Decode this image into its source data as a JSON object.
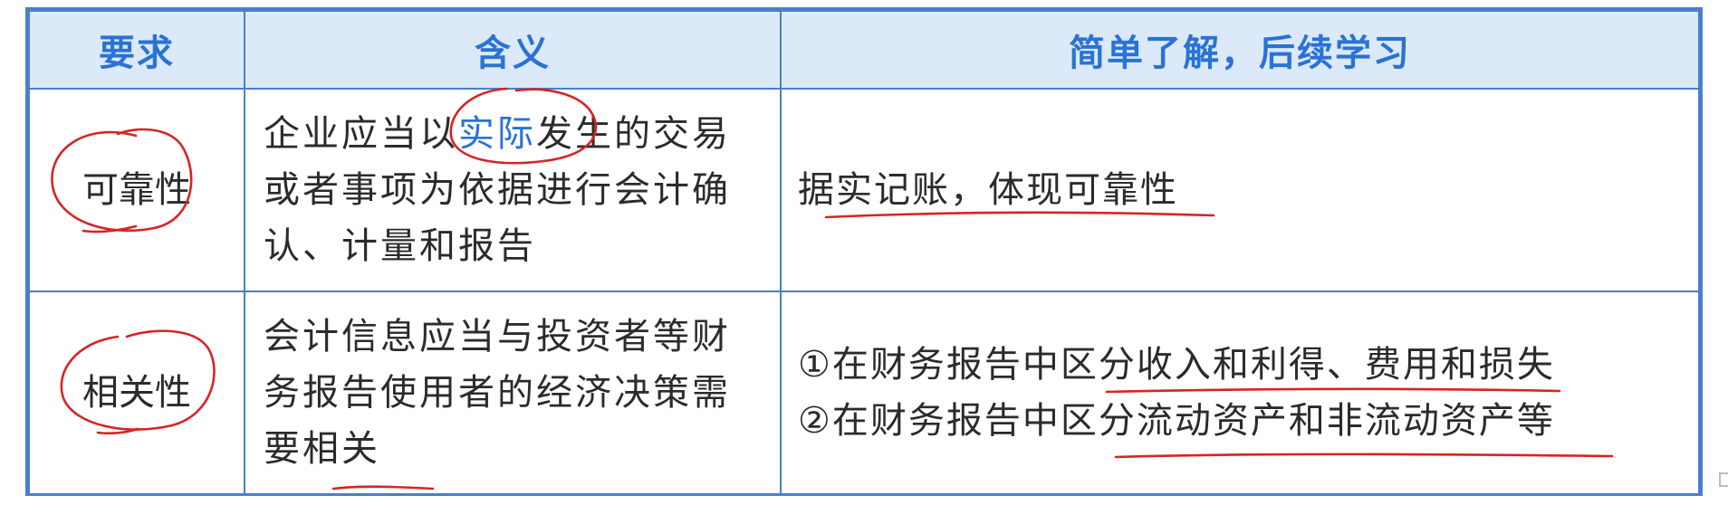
{
  "table": {
    "headers": [
      "要求",
      "含义",
      "简单了解，后续学习"
    ],
    "rows": [
      {
        "requirement": "可靠性",
        "meaning_before": "企业应当以",
        "meaning_highlight": "实际",
        "meaning_after": "发生的交易或者事项为依据进行会计确认、计量和报告",
        "notes": [
          "据实记账，体现可靠性"
        ]
      },
      {
        "requirement": "相关性",
        "meaning_before": "会计信息应当与投资者等财务报告使用者的经济决策需要相关",
        "meaning_highlight": "",
        "meaning_after": "",
        "notes": [
          "①在财务报告中区分收入和利得、费用和损失",
          "②在财务报告中区分流动资产和非流动资产等"
        ]
      }
    ]
  },
  "colors": {
    "border": "#4a7fc8",
    "header_bg": "#dbe9f8",
    "header_text": "#2a72d6",
    "highlight_text": "#2a72d6",
    "body_text": "#2b2b2b",
    "annotation": "#d62424"
  }
}
